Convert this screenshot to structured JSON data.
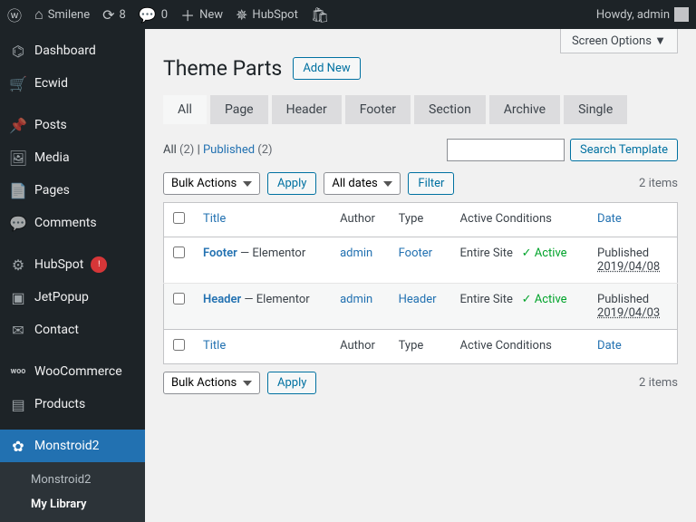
{
  "adminbar": {
    "site": "Smilene",
    "updates": "8",
    "comments": "0",
    "new": "New",
    "hubspot": "HubSpot",
    "greeting": "Howdy, admin"
  },
  "sidebar": {
    "items": [
      {
        "icon": "⌬",
        "label": "Dashboard"
      },
      {
        "icon": "🛒",
        "label": "Ecwid"
      },
      {
        "icon": "📌",
        "label": "Posts"
      },
      {
        "icon": "🖼",
        "label": "Media"
      },
      {
        "icon": "📄",
        "label": "Pages"
      },
      {
        "icon": "💬",
        "label": "Comments"
      },
      {
        "icon": "⚙",
        "label": "HubSpot",
        "badge": "!"
      },
      {
        "icon": "▣",
        "label": "JetPopup"
      },
      {
        "icon": "✉",
        "label": "Contact"
      },
      {
        "icon": "woo",
        "label": "WooCommerce"
      },
      {
        "icon": "▤",
        "label": "Products"
      },
      {
        "icon": "✿",
        "label": "Monstroid2",
        "current": true
      }
    ],
    "submenu": [
      "Monstroid2",
      "My Library"
    ],
    "submenu_current": 1
  },
  "screenoptions": "Screen Options ▼",
  "heading": {
    "title": "Theme Parts",
    "add": "Add New"
  },
  "tabs": [
    "All",
    "Page",
    "Header",
    "Footer",
    "Section",
    "Archive",
    "Single"
  ],
  "active_tab": 0,
  "subsub": {
    "all_label": "All",
    "all_count": "(2)",
    "sep": " | ",
    "pub_label": "Published",
    "pub_count": "(2)"
  },
  "search_button": "Search Template",
  "bulk_actions": "Bulk Actions",
  "apply": "Apply",
  "all_dates": "All dates",
  "filter": "Filter",
  "items_count": "2 items",
  "columns": {
    "title": "Title",
    "author": "Author",
    "type": "Type",
    "cond": "Active Conditions",
    "date": "Date"
  },
  "rows": [
    {
      "title": "Footer",
      "suffix": " — Elementor",
      "author": "admin",
      "type": "Footer",
      "cond_text": "Entire Site",
      "cond_active": "✓ Active",
      "date_label": "Published",
      "date_value": "2019/04/08"
    },
    {
      "title": "Header",
      "suffix": " — Elementor",
      "author": "admin",
      "type": "Header",
      "cond_text": "Entire Site",
      "cond_active": "✓ Active",
      "date_label": "Published",
      "date_value": "2019/04/03"
    }
  ]
}
